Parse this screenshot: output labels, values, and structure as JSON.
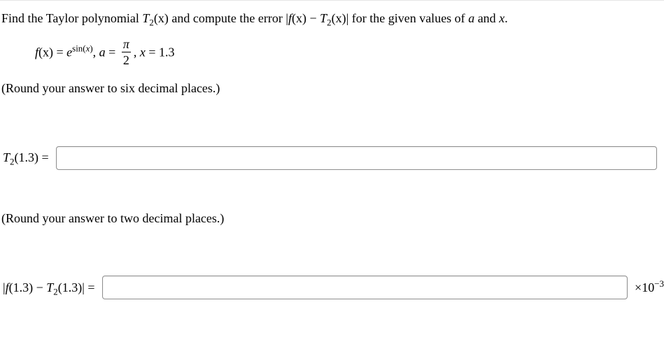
{
  "prompt": {
    "line1_pre": "Find the Taylor polynomial ",
    "line1_T": "T",
    "line1_T_sub": "2",
    "line1_T_arg": "(x)",
    "line1_mid": " and compute the error |",
    "line1_f": "f",
    "line1_farg": "(x)",
    "line1_minus": " − ",
    "line1_T2": "T",
    "line1_T2_sub": "2",
    "line1_T2_arg": "(x)",
    "line1_post": "| for the given values of ",
    "line1_a": "a",
    "line1_and": " and ",
    "line1_x": "x",
    "line1_period": "."
  },
  "defn": {
    "f": "f",
    "arg": "(x) = ",
    "e": "e",
    "exp_pre": "sin(",
    "exp_x": "x",
    "exp_post": ")",
    "comma": ", ",
    "a": "a",
    "eq": " = ",
    "frac_num": "π",
    "frac_den": "2",
    "comma2": ", ",
    "x": "x",
    "eq2": " = ",
    "xval": "1.3"
  },
  "round1": "(Round your answer to six decimal places.)",
  "q1": {
    "T": "T",
    "sub": "2",
    "arg": "(1.3) = "
  },
  "round2": "(Round your answer to two decimal places.)",
  "q2": {
    "bar": "|",
    "f": "f",
    "farg": "(1.3)",
    "minus": " − ",
    "T": "T",
    "Tsub": "2",
    "Targ": "(1.3)",
    "bar2": "| = ",
    "unit_pre": "×10",
    "unit_exp": "−3"
  }
}
